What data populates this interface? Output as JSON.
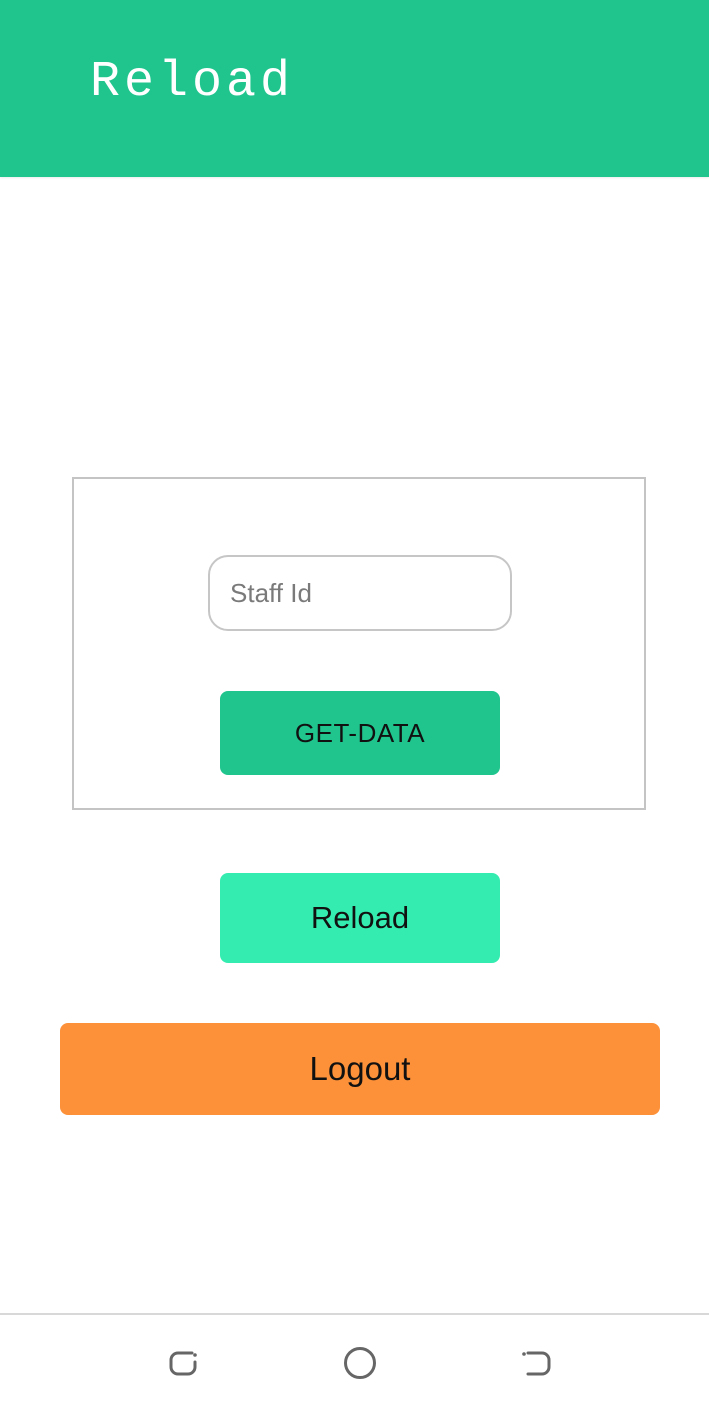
{
  "app_bar": {
    "title": "Reload",
    "background_color": "#20c58e"
  },
  "form": {
    "staff_id_placeholder": "Staff Id",
    "staff_id_value": "",
    "get_data_label": "GET-DATA",
    "get_data_color": "#20c58e"
  },
  "actions": {
    "reload_label": "Reload",
    "reload_color": "#35ecb0",
    "logout_label": "Logout",
    "logout_color": "#fc9139"
  },
  "system_nav": {
    "buttons": [
      {
        "icon": "recents-icon"
      },
      {
        "icon": "home-icon"
      },
      {
        "icon": "back-icon"
      }
    ]
  }
}
